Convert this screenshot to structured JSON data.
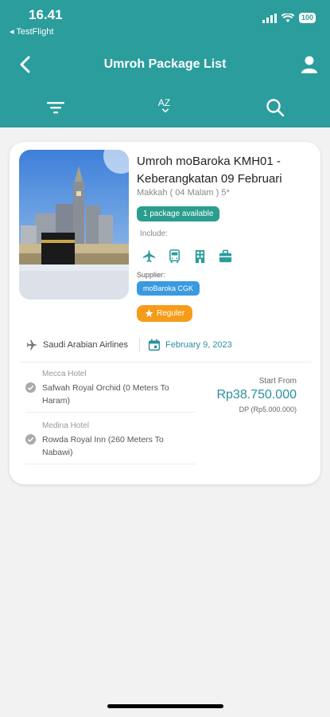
{
  "status": {
    "time": "16.41",
    "back_app": "◂ TestFlight",
    "battery": "100"
  },
  "nav": {
    "title": "Umroh Package List"
  },
  "toolbar": {
    "sort_label": "AZ"
  },
  "package": {
    "title": "Umroh moBaroka KMH01 - Keberangkatan 09 Februari",
    "subtitle": "Makkah ( 04 Malam ) 5*",
    "availability": "1 package available",
    "include_label": "Include:",
    "include_icons": [
      "plane-icon",
      "bus-icon",
      "hotel-icon",
      "luggage-icon"
    ],
    "supplier_label": "Supplier:",
    "supplier": "moBaroka CGK",
    "class_badge": "Reguler",
    "airline": "Saudi Arabian Airlines",
    "departure_date": "February 9, 2023",
    "hotels": [
      {
        "label": "Mecca Hotel",
        "name": "Safwah Royal Orchid (0 Meters To Haram)"
      },
      {
        "label": "Medina Hotel",
        "name": "Rowda Royal Inn (260 Meters To Nabawi)"
      }
    ],
    "price_label": "Start From",
    "price": "Rp38.750.000",
    "dp": "DP (Rp5.000.000)"
  },
  "colors": {
    "primary": "#2a9d9c",
    "badge_green": "#2a9d8f",
    "supplier_blue": "#3a9ae0",
    "reguler_orange": "#f59c1a",
    "price_teal": "#2a8f9f"
  }
}
